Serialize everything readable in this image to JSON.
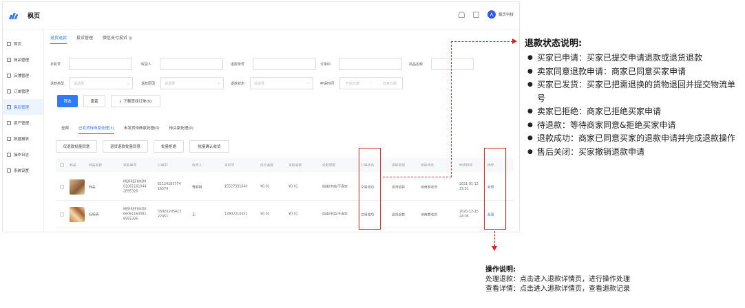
{
  "app": {
    "brand": "枫页",
    "user_name": "枫页科技",
    "avatar_text": "A"
  },
  "sidebar": {
    "items": [
      {
        "label": "首页",
        "icon": "home-icon"
      },
      {
        "label": "商品管理",
        "icon": "box-icon"
      },
      {
        "label": "店铺管理",
        "icon": "shop-icon"
      },
      {
        "label": "订单管理",
        "icon": "order-icon"
      },
      {
        "label": "售后管理",
        "icon": "after-sale-icon"
      },
      {
        "label": "资产管理",
        "icon": "asset-icon"
      },
      {
        "label": "数据报表",
        "icon": "report-icon"
      },
      {
        "label": "操作日志",
        "icon": "log-icon"
      },
      {
        "label": "系统设置",
        "icon": "settings-icon"
      }
    ]
  },
  "tabs": [
    "退货退款",
    "投诉管理",
    "微信支付投诉"
  ],
  "filters": {
    "phone": "手机号",
    "receiver": "收货人",
    "refund_no": "退款单号",
    "order_id": "订单ID",
    "product_name": "商品名称",
    "refund_type": "退款类型",
    "refund_type_ph": "请选择",
    "refund_reason": "退款原因",
    "refund_reason_ph": "请选择",
    "refund_status": "退款状态",
    "refund_status_ph": "请选择",
    "apply_time": "申请时间",
    "date_start": "开始日期",
    "date_sep": "-",
    "date_end": "结束日期"
  },
  "buttons": {
    "filter": "筛选",
    "reset": "重置",
    "download": "下载查找订单(0)"
  },
  "subtabs": [
    "全部",
    "已发货待商家处理(3)",
    "未发货待商家处理(0)",
    "待买家处理(0)"
  ],
  "batch_buttons": [
    "仅退款批量同意",
    "退货退款批量同意",
    "批量拒绝",
    "批量确认收货"
  ],
  "table": {
    "headers": [
      "商品",
      "商品名称",
      "退款单号",
      "订单ID",
      "收货人",
      "手机号",
      "成交金额",
      "退款金额",
      "退款原因",
      "订单状态",
      "退款类型",
      "退款状态",
      "申请时间",
      "操作"
    ],
    "rows": [
      {
        "name": "商品",
        "refund_no": "MERREFUND0 02061161044 2895326",
        "order_id": "E1124283774 16579",
        "receiver": "曹嗣刚",
        "phone": "15527331640",
        "deal": "¥0.01",
        "refund": "¥0.01",
        "reason": "拍错/多拍/不喜欢",
        "order_status": "交易成功",
        "type": "退货退款",
        "status": "待商家收货",
        "time": "2021-01-12 23:31",
        "action": "处理"
      },
      {
        "name": "标明明",
        "refund_no": "MERREFUND0 06061160081 6955326",
        "order_id": "D9161205413 22451",
        "receiver": "王",
        "phone": "13902210431",
        "deal": "¥0.01",
        "refund": "¥0.01",
        "reason": "拍错/多拍/不喜欢",
        "order_status": "交易成功",
        "type": "退货退款",
        "status": "待商家收货",
        "time": "2020-12-15 24:05",
        "action": "处理"
      }
    ]
  },
  "notes": {
    "title": "退款状态说明:",
    "items": [
      "买家已申请：买家已提交申请退款或退货退款",
      "卖家同意退款申请：商家已同意买家申请",
      "买家已发货：买家已把需退换的货物退回并提交物流单号",
      "卖家已拒绝：商家已拒绝买家申请",
      "待退款：等待商家同意&拒绝买家申请",
      "退款成功：商家已同意买家的退款申请并完成退款操作",
      "售后关闭：买家撤销退款申请"
    ]
  },
  "op_notes": {
    "title": "操作说明:",
    "lines": [
      "处理退款：点击进入退款详情页，进行操作处理",
      "查看详情：点击进入退款详情页，查看退款记录"
    ]
  },
  "colors": {
    "accent": "#2f7bf6",
    "annotation": "#e02020"
  }
}
